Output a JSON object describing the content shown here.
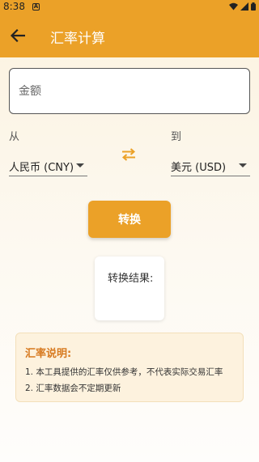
{
  "status_bar": {
    "time": "8:38",
    "notification_badge": "A"
  },
  "app_bar": {
    "title": "汇率计算",
    "back_icon": "arrow-left-icon"
  },
  "amount": {
    "placeholder": "金额",
    "value": ""
  },
  "from": {
    "label": "从",
    "selected": "人民币 (CNY)"
  },
  "to": {
    "label": "到",
    "selected": "美元 (USD)"
  },
  "swap_icon": "swap-arrows-icon",
  "convert_button": {
    "label": "转换"
  },
  "result": {
    "label": "转换结果:"
  },
  "info": {
    "title": "汇率说明:",
    "items": [
      "1. 本工具提供的汇率仅供参考，不代表实际交易汇率",
      "2. 汇率数据会不定期更新"
    ]
  },
  "colors": {
    "primary": "#eba128",
    "info_title": "#d7791f",
    "info_background": "#fdf2de"
  }
}
